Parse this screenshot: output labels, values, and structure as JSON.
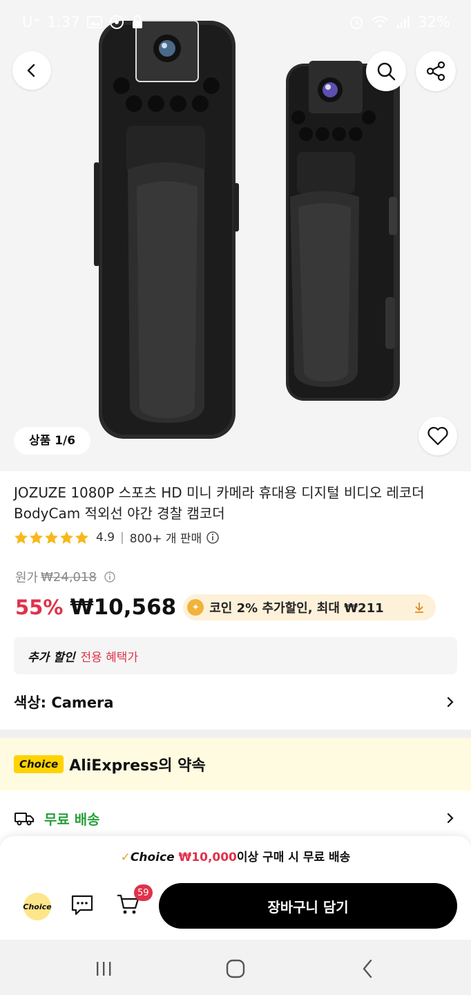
{
  "status_bar": {
    "carrier": "U⁺",
    "time": "1:37",
    "battery": "32%"
  },
  "gallery": {
    "counter": "상품 1/6",
    "icons": {
      "back": "chevron-left-icon",
      "search": "search-icon",
      "share": "share-icon",
      "wishlist": "heart-icon"
    }
  },
  "product": {
    "title": "JOZUZE 1080P 스포츠 HD 미니 카메라 휴대용 디지털 비디오 레코더 BodyCam 적외선 야간 경찰 캠코더",
    "rating": "4.9",
    "stars": 5,
    "sold": "800+ 개 판매",
    "original_price_label": "원가",
    "original_price": "₩24,018",
    "discount": "55%",
    "price": "₩10,568",
    "coin_offer": "코인 2% 추가할인, 최대 ₩211"
  },
  "extra_discount": {
    "label": "추가 할인",
    "detail": "전용 혜택가"
  },
  "color_option": {
    "label": "색상: Camera"
  },
  "promise": {
    "tag": "Choice",
    "text": "AliExpress의 약속"
  },
  "shipping": {
    "label": "무료 배송"
  },
  "bottom_bar": {
    "banner_choice": "Choice",
    "banner_amount": "₩10,000",
    "banner_rest": "이상 구매 시 무료 배송",
    "choice_circle": "Choice",
    "cart_count": "59",
    "add_to_cart": "장바구니 담기"
  },
  "colors": {
    "accent_red": "#e0324a",
    "choice_yellow": "#ffd300",
    "shipping_green": "#27a03a",
    "star": "#f6b91c"
  }
}
